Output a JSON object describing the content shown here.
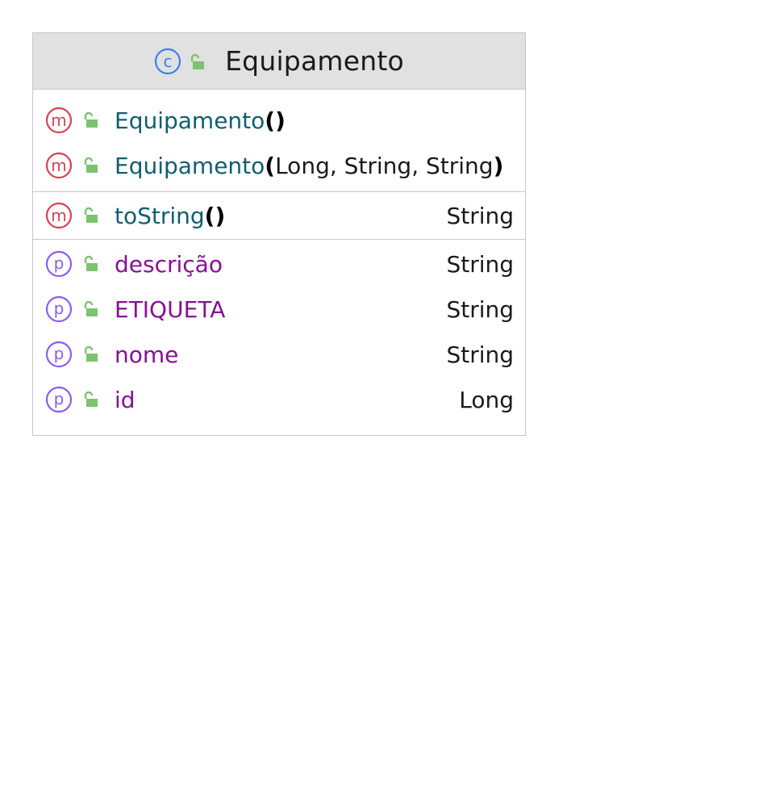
{
  "class": {
    "name": "Equipamento",
    "kind_letter": "c",
    "colors": {
      "class_badge": "#3d7ef0",
      "method_badge": "#d64254",
      "property_badge": "#8b5cf6",
      "lock": "#7cc36e",
      "header_bg": "#e1e1e1",
      "method_name": "#0e5e6f",
      "property_name": "#871094"
    }
  },
  "constructors": [
    {
      "name": "Equipamento",
      "open": "(",
      "params": "",
      "close": ")"
    },
    {
      "name": "Equipamento",
      "open": "(",
      "params": "Long, String, String",
      "close": ")"
    }
  ],
  "methods": [
    {
      "name": "toString",
      "open": "(",
      "params": "",
      "close": ")",
      "type": "String"
    }
  ],
  "properties": [
    {
      "name": "descrição",
      "type": "String"
    },
    {
      "name": "ETIQUETA",
      "type": "String"
    },
    {
      "name": "nome",
      "type": "String"
    },
    {
      "name": "id",
      "type": "Long"
    }
  ],
  "badge_letters": {
    "method": "m",
    "property": "p"
  }
}
